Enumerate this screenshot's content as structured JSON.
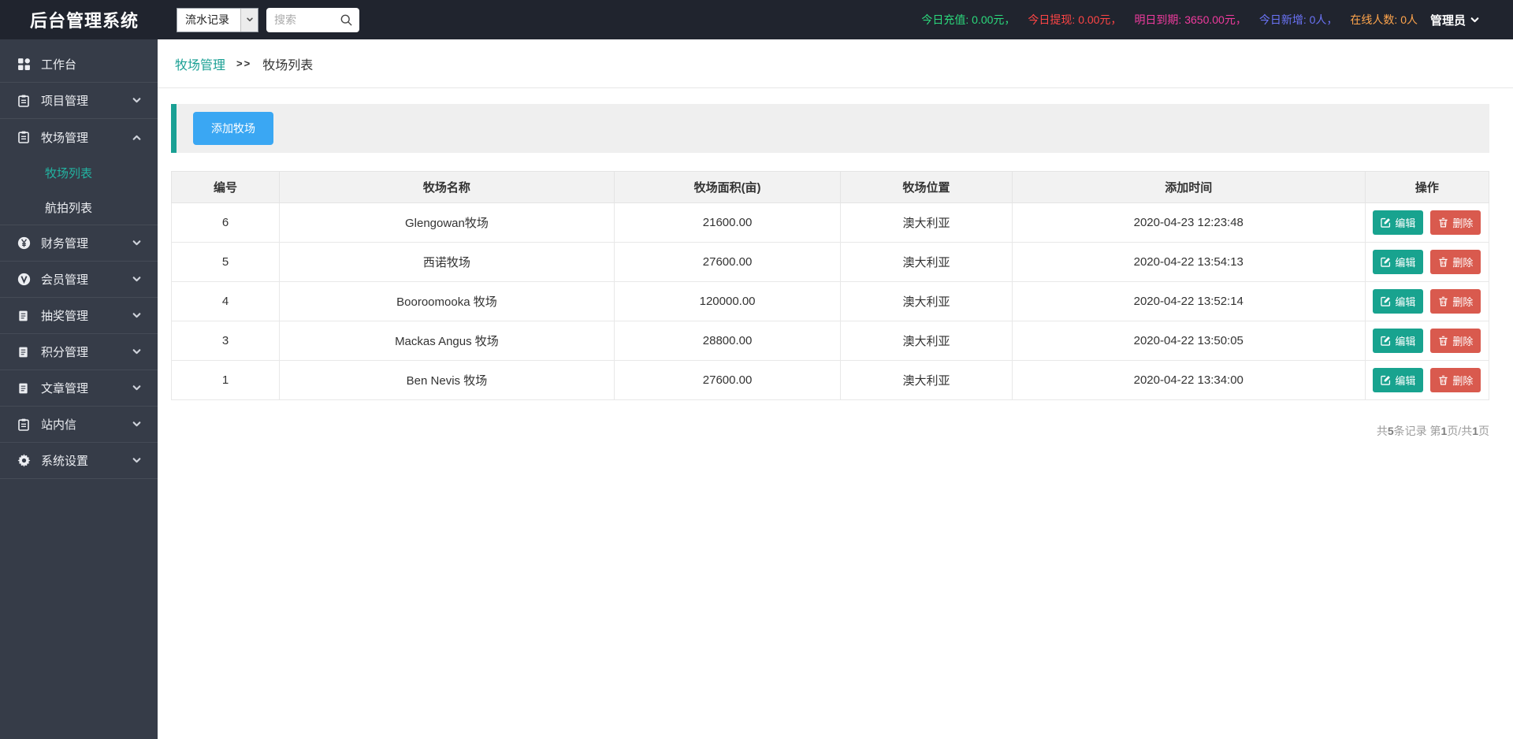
{
  "topbar": {
    "title": "后台管理系统",
    "select_value": "流水记录",
    "search_placeholder": "搜索",
    "stats": [
      {
        "key": "today-recharge",
        "label": "今日充值:",
        "value": "0.00元，",
        "color": "#2bd97c"
      },
      {
        "key": "today-withdraw",
        "label": "今日提现:",
        "value": "0.00元，",
        "color": "#ff4545"
      },
      {
        "key": "tomorrow-due",
        "label": "明日到期:",
        "value": "3650.00元，",
        "color": "#f03b9e"
      },
      {
        "key": "today-new",
        "label": "今日新增:",
        "value": "0人，",
        "color": "#6b74f8"
      },
      {
        "key": "online-count",
        "label": "在线人数:",
        "value": "0人",
        "color": "#ffa54c"
      }
    ],
    "admin_label": "管理员"
  },
  "sidebar": {
    "items": [
      {
        "key": "workbench",
        "label": "工作台",
        "icon": "grid-icon",
        "expandable": false
      },
      {
        "key": "project-management",
        "label": "项目管理",
        "icon": "clipboard-icon",
        "expandable": true,
        "state": "collapsed"
      },
      {
        "key": "farm-management",
        "label": "牧场管理",
        "icon": "clipboard-icon",
        "expandable": true,
        "state": "expanded",
        "children": [
          {
            "key": "farm-list",
            "label": "牧场列表",
            "active": true
          },
          {
            "key": "aerial-list",
            "label": "航拍列表",
            "active": false
          }
        ]
      },
      {
        "key": "finance-management",
        "label": "财务管理",
        "icon": "yen-circle-icon",
        "expandable": true,
        "state": "collapsed"
      },
      {
        "key": "member-management",
        "label": "会员管理",
        "icon": "member-circle-icon",
        "expandable": true,
        "state": "collapsed"
      },
      {
        "key": "lottery-management",
        "label": "抽奖管理",
        "icon": "document-icon",
        "expandable": true,
        "state": "collapsed"
      },
      {
        "key": "points-management",
        "label": "积分管理",
        "icon": "document-icon",
        "expandable": true,
        "state": "collapsed"
      },
      {
        "key": "article-management",
        "label": "文章管理",
        "icon": "document-icon",
        "expandable": true,
        "state": "collapsed"
      },
      {
        "key": "site-mail",
        "label": "站内信",
        "icon": "clipboard-icon",
        "expandable": true,
        "state": "collapsed"
      },
      {
        "key": "system-settings",
        "label": "系统设置",
        "icon": "gear-icon",
        "expandable": true,
        "state": "collapsed"
      }
    ]
  },
  "breadcrumb": {
    "parent": "牧场管理",
    "separator": ">>",
    "current": "牧场列表"
  },
  "toolbar": {
    "add_button": "添加牧场"
  },
  "table": {
    "headers": [
      "编号",
      "牧场名称",
      "牧场面积(亩)",
      "牧场位置",
      "添加时间",
      "操作"
    ],
    "rows": [
      {
        "id": "6",
        "name": "Glengowan牧场",
        "area": "21600.00",
        "location": "澳大利亚",
        "time": "2020-04-23 12:23:48"
      },
      {
        "id": "5",
        "name": "西诺牧场",
        "area": "27600.00",
        "location": "澳大利亚",
        "time": "2020-04-22 13:54:13"
      },
      {
        "id": "4",
        "name": "Booroomooka 牧场",
        "area": "120000.00",
        "location": "澳大利亚",
        "time": "2020-04-22 13:52:14"
      },
      {
        "id": "3",
        "name": "Mackas Angus 牧场",
        "area": "28800.00",
        "location": "澳大利亚",
        "time": "2020-04-22 13:50:05"
      },
      {
        "id": "1",
        "name": "Ben Nevis 牧场",
        "area": "27600.00",
        "location": "澳大利亚",
        "time": "2020-04-22 13:34:00"
      }
    ],
    "edit_label": "编辑",
    "delete_label": "删除"
  },
  "pagination": {
    "p0": "共",
    "total": "5",
    "p1": "条记录 第",
    "page": "1",
    "p2": "页/共",
    "pages": "1",
    "p3": "页"
  },
  "colors": {
    "topbar_bg": "#20242e",
    "sidebar_bg": "#363c48",
    "accent_teal": "#1aa094",
    "add_button_blue": "#3aa7f3",
    "edit_button": "#18a38f",
    "delete_button": "#d95a4e",
    "active_menu": "#22b3a1"
  }
}
